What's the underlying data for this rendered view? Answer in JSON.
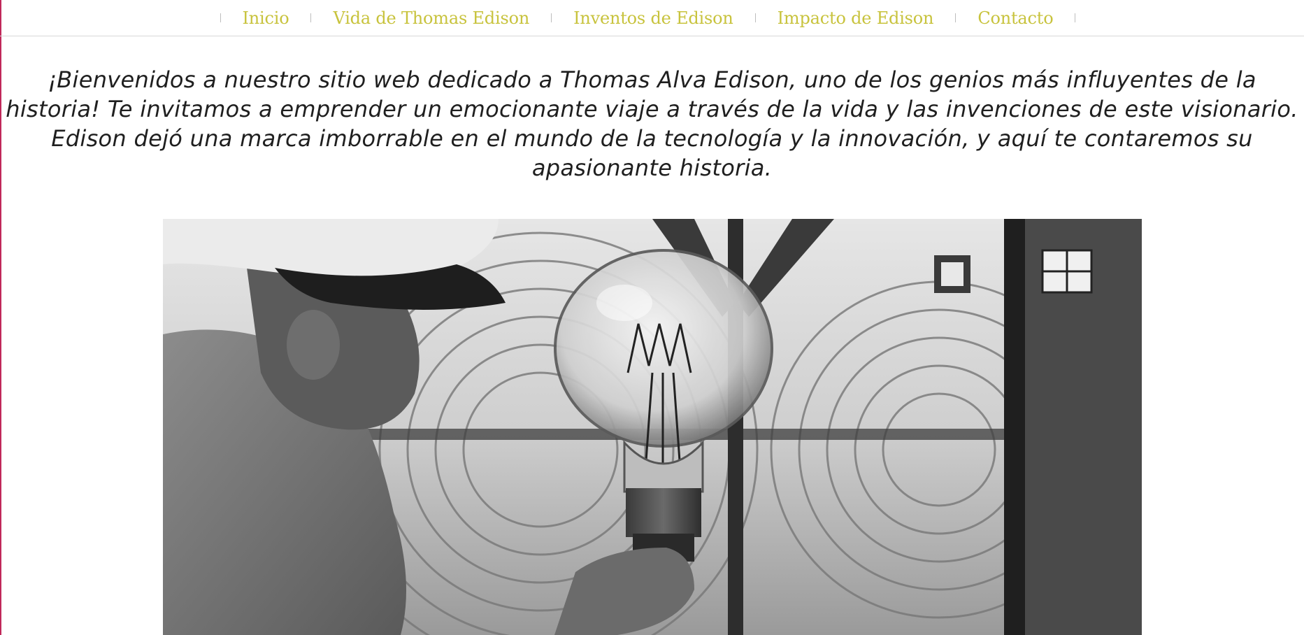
{
  "nav": {
    "items": [
      {
        "label": "Inicio"
      },
      {
        "label": "Vida de Thomas Edison"
      },
      {
        "label": "Inventos de Edison"
      },
      {
        "label": "Impacto de Edison"
      },
      {
        "label": "Contacto"
      }
    ]
  },
  "intro": {
    "line1": "¡Bienvenidos a nuestro sitio web dedicado a Thomas Alva Edison, uno de los genios más influyentes de la",
    "line2": "historia! Te invitamos a emprender un emocionante viaje a través de la vida y las invenciones de este visionario.",
    "line3": "Edison dejó una marca imborrable en el mundo de la tecnología y la innovación, y aquí te contaremos su",
    "line4": "apasionante historia."
  },
  "colors": {
    "nav_link": "#c8c33d",
    "left_edge": "#c0285a"
  },
  "hero_image": {
    "description_icon": "photo-lightbulb-lighthouse-keeper"
  }
}
